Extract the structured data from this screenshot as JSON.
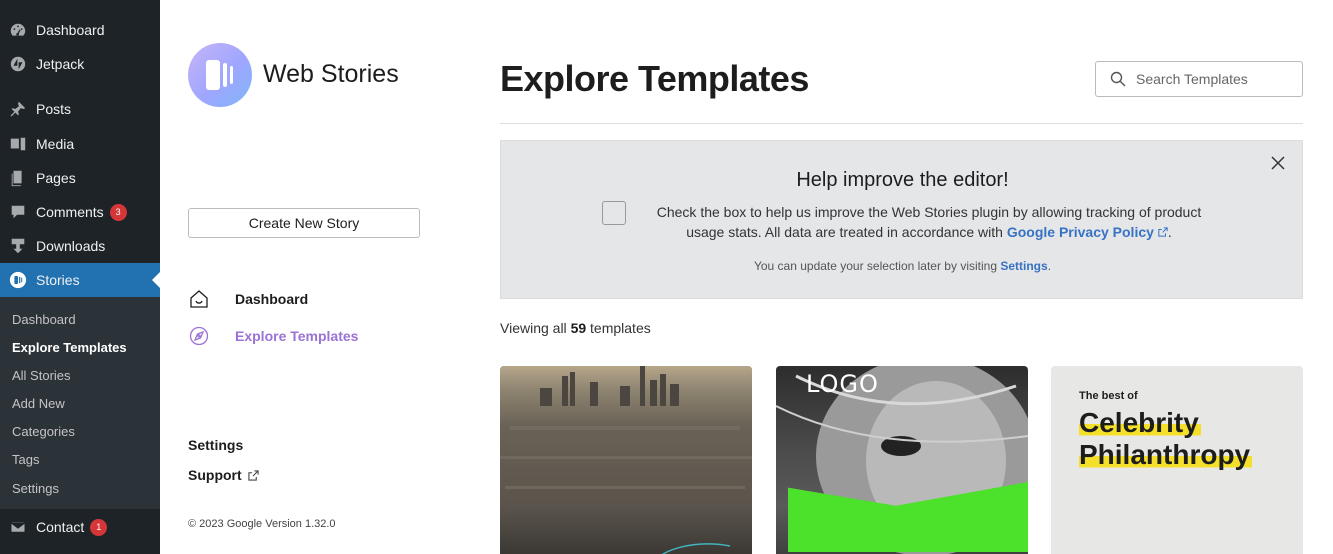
{
  "wp_menu": {
    "items": [
      {
        "label": "Dashboard",
        "icon": "dashboard-icon"
      },
      {
        "label": "Jetpack",
        "icon": "jetpack-icon"
      },
      {
        "label": "Posts",
        "icon": "pin-icon"
      },
      {
        "label": "Media",
        "icon": "media-icon"
      },
      {
        "label": "Pages",
        "icon": "pages-icon"
      },
      {
        "label": "Comments",
        "icon": "comment-icon",
        "badge": "3"
      },
      {
        "label": "Downloads",
        "icon": "download-icon"
      },
      {
        "label": "Stories",
        "icon": "stories-icon"
      }
    ],
    "submenu": [
      "Dashboard",
      "Explore Templates",
      "All Stories",
      "Add New",
      "Categories",
      "Tags",
      "Settings"
    ],
    "contact": {
      "label": "Contact",
      "badge": "1"
    }
  },
  "ws_nav": {
    "brand": "Web Stories",
    "create_label": "Create New Story",
    "links": [
      {
        "label": "Dashboard",
        "icon": "home-icon"
      },
      {
        "label": "Explore Templates",
        "icon": "compass-icon"
      }
    ],
    "settings": "Settings",
    "support": "Support",
    "copyright": "© 2023 Google Version 1.32.0"
  },
  "main": {
    "title": "Explore Templates",
    "search_placeholder": "Search Templates",
    "banner": {
      "title": "Help improve the editor!",
      "body_prefix": "Check the box to help us improve the Web Stories plugin by allowing tracking of product usage stats. All data are treated in accordance with",
      "policy_link": "Google Privacy Policy",
      "body_suffix": ".",
      "note_prefix": "You can update your selection later by visiting",
      "note_link": "Settings",
      "note_suffix": "."
    },
    "viewing_prefix": "Viewing all",
    "viewing_count": "59",
    "viewing_suffix": "templates",
    "cards": [
      {
        "text": ""
      },
      {
        "logo": "LOGO"
      },
      {
        "kicker": "The best of",
        "line1": "Celebrity",
        "line2": "Philanthropy"
      }
    ]
  },
  "colors": {
    "wp_bg": "#1d2327",
    "wp_active": "#2271b1",
    "accent_purple": "#9b72d6",
    "link_blue": "#3872c4",
    "green": "#4ce12a",
    "highlight_yellow": "#f4e02a"
  }
}
